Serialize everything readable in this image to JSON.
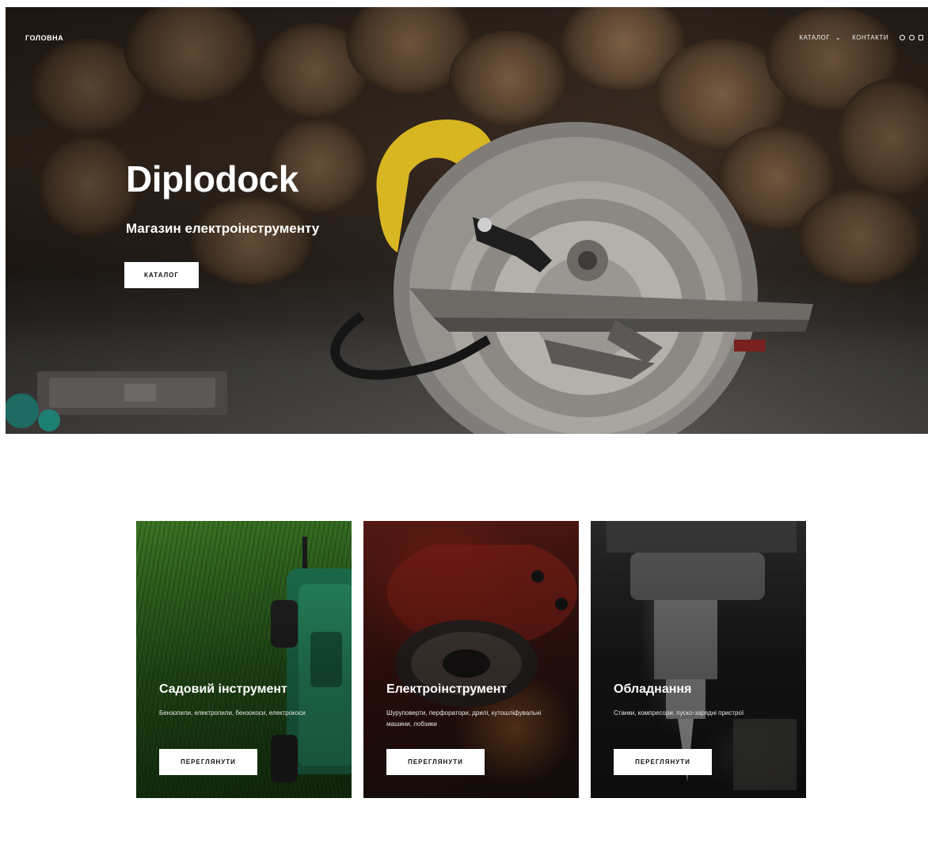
{
  "nav": {
    "home": "ГОЛОВНА",
    "catalog": "КАТАЛОГ",
    "catalog_caret": "⌄",
    "contacts": "КОНТАКТИ",
    "icons": [
      "search-icon",
      "user-icon",
      "cart-icon"
    ]
  },
  "hero": {
    "title": "Diplodock",
    "subtitle": "Магазин електроінструменту",
    "button": "КАТАЛОГ"
  },
  "cards": [
    {
      "title": "Садовий інструмент",
      "description": "Бензопили, електропили, бензокоси, електрокоси",
      "button": "ПЕРЕГЛЯНУТИ"
    },
    {
      "title": "Електроінструмент",
      "description": "Шуруповерти, перфоратори, дрилі, кутошліфувальні машини, лобзики",
      "button": "ПЕРЕГЛЯНУТИ"
    },
    {
      "title": "Обладнання",
      "description": "Станки, компресори, пуско-зарядні пристрої",
      "button": "ПЕРЕГЛЯНУТИ"
    }
  ],
  "colors": {
    "button_bg": "#ffffff",
    "text_light": "#ffffff",
    "saw_accent": "#e3c229"
  }
}
